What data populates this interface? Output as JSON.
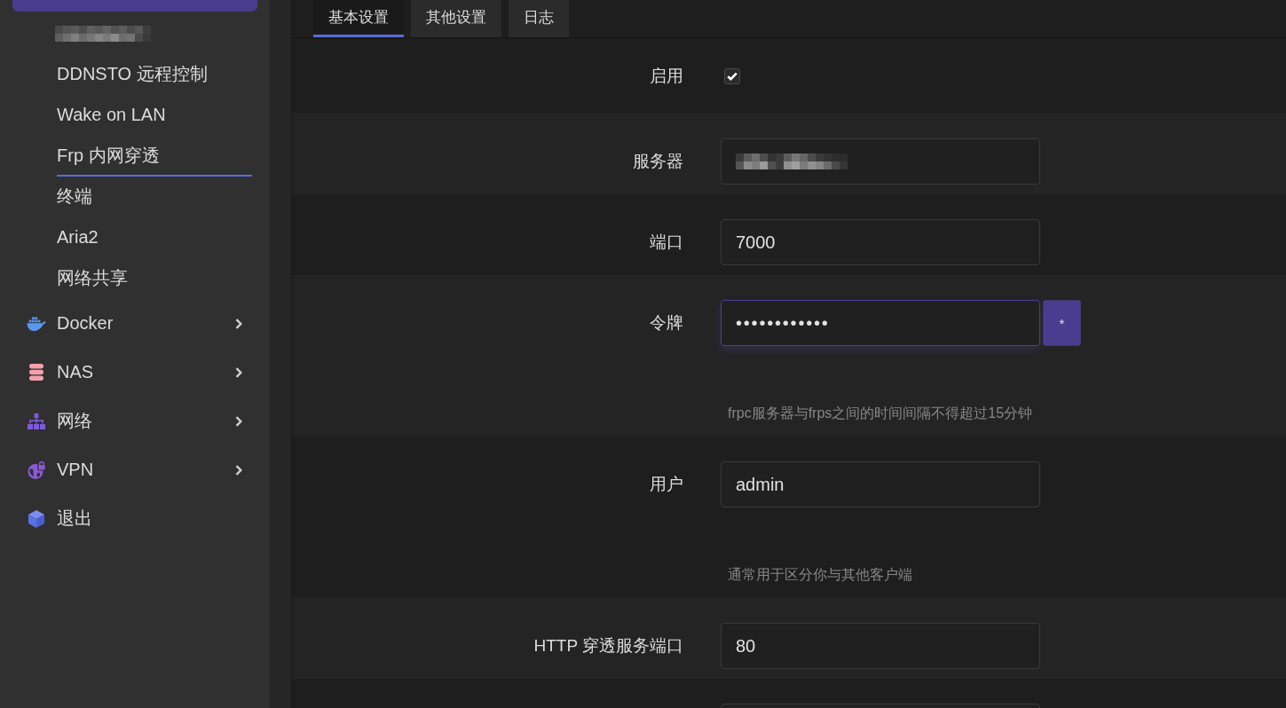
{
  "sidebar": {
    "submenu": [
      {
        "label": "DDNSTO 远程控制",
        "selected": false
      },
      {
        "label": "Wake on LAN",
        "selected": false
      },
      {
        "label": "Frp 内网穿透",
        "selected": true
      },
      {
        "label": "终端",
        "selected": false
      },
      {
        "label": "Aria2",
        "selected": false
      },
      {
        "label": "网络共享",
        "selected": false
      }
    ],
    "menu": [
      {
        "label": "Docker",
        "expandable": true
      },
      {
        "label": "NAS",
        "expandable": true
      },
      {
        "label": "网络",
        "expandable": true
      },
      {
        "label": "VPN",
        "expandable": true
      },
      {
        "label": "退出",
        "expandable": false
      }
    ]
  },
  "tabs": [
    {
      "label": "基本设置",
      "selected": true
    },
    {
      "label": "其他设置",
      "selected": false
    },
    {
      "label": "日志",
      "selected": false
    }
  ],
  "form": {
    "rows": [
      {
        "kind": "checkbox",
        "label": "启用",
        "checked": true
      },
      {
        "kind": "redacted",
        "label": "服务器",
        "focused": false
      },
      {
        "kind": "text",
        "label": "端口",
        "value": "7000",
        "focused": false
      },
      {
        "kind": "password",
        "label": "令牌",
        "value": "••••••••••••",
        "focused": true,
        "button": "*",
        "hint": "frpc服务器与frps之间的时间间隔不得超过15分钟"
      },
      {
        "kind": "text",
        "label": "用户",
        "value": "admin",
        "focused": false,
        "hint": "通常用于区分你与其他客户端"
      },
      {
        "kind": "text",
        "label": "HTTP 穿透服务端口",
        "value": "80",
        "focused": false
      },
      {
        "kind": "text",
        "focused": false
      }
    ]
  }
}
